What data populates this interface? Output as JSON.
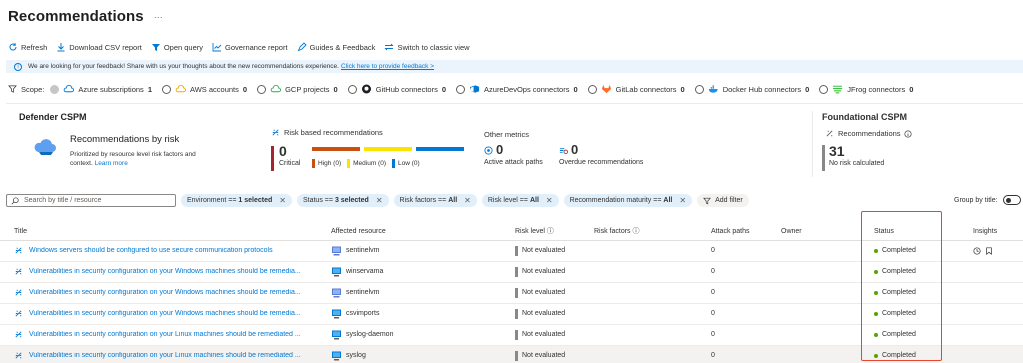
{
  "page": {
    "title": "Recommendations",
    "more": "···"
  },
  "toolbar": [
    {
      "icon": "refresh-icon",
      "label": "Refresh"
    },
    {
      "icon": "download-icon",
      "label": "Download CSV report"
    },
    {
      "icon": "query-icon",
      "label": "Open query"
    },
    {
      "icon": "chart-icon",
      "label": "Governance report"
    },
    {
      "icon": "feedback-icon",
      "label": "Guides & Feedback"
    },
    {
      "icon": "switch-icon",
      "label": "Switch to classic view"
    }
  ],
  "banner": {
    "text": "We are looking for your feedback! Share with us your thoughts about the new recommendations experience.",
    "link": "Click here to provide feedback >"
  },
  "scope": {
    "label": "Scope:",
    "items": [
      {
        "label": "Azure subscriptions",
        "count": "1"
      },
      {
        "label": "AWS accounts",
        "count": "0"
      },
      {
        "label": "GCP projects",
        "count": "0"
      },
      {
        "label": "GitHub connectors",
        "count": "0"
      },
      {
        "label": "AzureDevOps connectors",
        "count": "0"
      },
      {
        "label": "GitLab connectors",
        "count": "0"
      },
      {
        "label": "Docker Hub connectors",
        "count": "0"
      },
      {
        "label": "JFrog connectors",
        "count": "0"
      }
    ]
  },
  "defender": {
    "title": "Defender CSPM",
    "rbr_title": "Recommendations by risk",
    "rbr_desc": "Prioritized by resource level risk factors and context.",
    "learn_more": "Learn more",
    "risk_title": "Risk based recommendations",
    "critical_count": "0",
    "critical_label": "Critical",
    "high": "High (0)",
    "medium": "Medium (0)",
    "low": "Low (0)",
    "other_title": "Other metrics",
    "attack_paths_count": "0",
    "attack_paths_label": "Active attack paths",
    "overdue_count": "0",
    "overdue_label": "Overdue recommendations"
  },
  "foundational": {
    "title": "Foundational CSPM",
    "rec_label": "Recommendations",
    "count": "31",
    "count_label": "No risk calculated"
  },
  "filters": {
    "search_placeholder": "Search by title / resource",
    "pills": [
      {
        "label": "Environment ==",
        "value": "1 selected"
      },
      {
        "label": "Status ==",
        "value": "3 selected"
      },
      {
        "label": "Risk factors ==",
        "value": "All"
      },
      {
        "label": "Risk level ==",
        "value": "All"
      },
      {
        "label": "Recommendation maturity ==",
        "value": "All"
      }
    ],
    "add_filter": "Add filter",
    "group_by": "Group by title:"
  },
  "table": {
    "columns": [
      "Title",
      "Affected resource",
      "Risk level",
      "Risk factors",
      "Attack paths",
      "Owner",
      "Status",
      "Insights"
    ],
    "rows": [
      {
        "title": "Windows servers should be configured to use secure communication protocols",
        "resource": "sentinelvm",
        "risk": "Not evaluated",
        "attack": "0",
        "status": "Completed"
      },
      {
        "title": "Vulnerabilities in security configuration on your Windows machines should be remedia...",
        "resource": "winservama",
        "risk": "Not evaluated",
        "attack": "0",
        "status": "Completed"
      },
      {
        "title": "Vulnerabilities in security configuration on your Windows machines should be remedia...",
        "resource": "sentinelvm",
        "risk": "Not evaluated",
        "attack": "0",
        "status": "Completed"
      },
      {
        "title": "Vulnerabilities in security configuration on your Windows machines should be remedia...",
        "resource": "csvimports",
        "risk": "Not evaluated",
        "attack": "0",
        "status": "Completed"
      },
      {
        "title": "Vulnerabilities in security configuration on your Linux machines should be remediated ...",
        "resource": "syslog-daemon",
        "risk": "Not evaluated",
        "attack": "0",
        "status": "Completed"
      },
      {
        "title": "Vulnerabilities in security configuration on your Linux machines should be remediated ...",
        "resource": "syslog",
        "risk": "Not evaluated",
        "attack": "0",
        "status": "Completed"
      }
    ]
  },
  "colors": {
    "accent": "#0078d4",
    "critical": "#a4262c",
    "high": "#ca5010",
    "medium": "#fde300",
    "low": "#0078d4",
    "completed": "#57a300",
    "highlight_box": "#e8452c"
  }
}
